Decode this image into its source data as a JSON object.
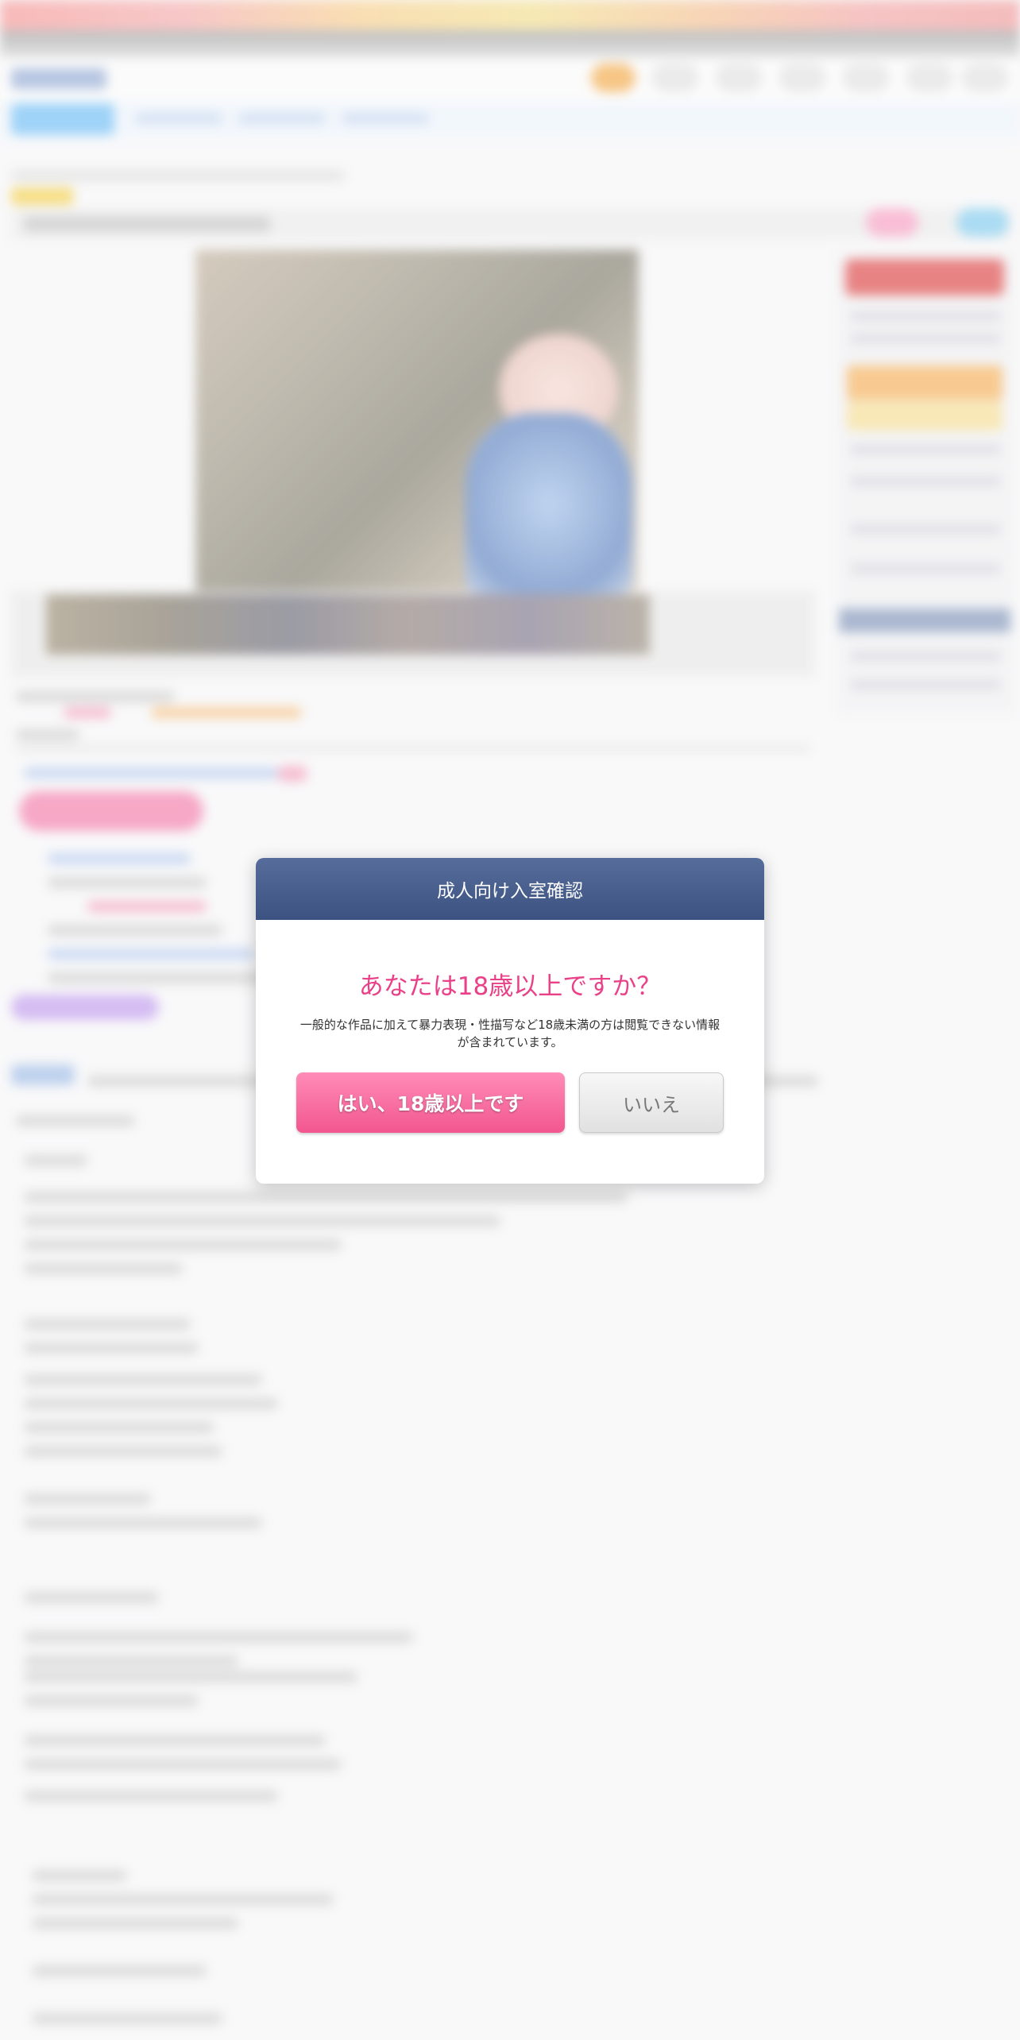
{
  "modal": {
    "header_title": "成人向け入室確認",
    "question": "あなたは18歳以上ですか？",
    "description_line1": "一般的な作品に加えて暴力表現・性描写など18歳未満の方は閲覧できない情報",
    "description_line2": "が含まれています。",
    "yes_label": "はい、18歳以上です",
    "no_label": "いいえ"
  },
  "colors": {
    "header_bg": "#3f5583",
    "question_text": "#e94088",
    "yes_button": "#f45e95",
    "no_button": "#e7e7e7"
  }
}
